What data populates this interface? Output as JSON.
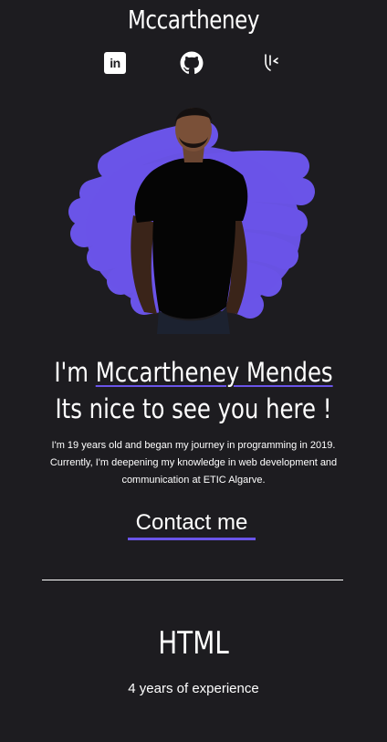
{
  "header": {
    "title": "Mccartheney"
  },
  "social": {
    "linkedin_label": "in",
    "linkedin_icon": "linkedin-icon",
    "github_icon": "github-icon",
    "extra_icon": "custom-logo-icon"
  },
  "hero": {
    "accent_color": "#6a54e8",
    "image": "portrait-photo"
  },
  "intro": {
    "prefix": "I'm ",
    "name": "Mccartheney Mendes",
    "greeting": "Its nice to see you here !",
    "bio": "I'm 19 years old and began my journey in programming in 2019. Currently, I'm deepening my knowledge in web development and communication at ETIC Algarve."
  },
  "contact": {
    "label": "Contact me"
  },
  "skills": [
    {
      "name": "HTML",
      "experience": "4 years of experience"
    }
  ],
  "theme": {
    "background": "#1d1c20",
    "text": "#ffffff",
    "accent": "#6a54e8"
  }
}
